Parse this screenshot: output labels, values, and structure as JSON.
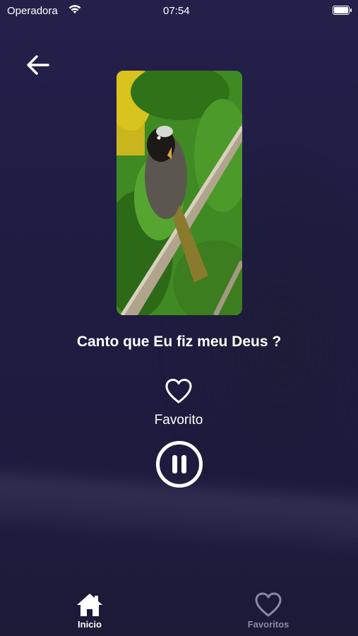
{
  "status_bar": {
    "carrier": "Operadora",
    "time": "07:54"
  },
  "player": {
    "image_alt": "Pássaro em um galho",
    "title": "Canto que Eu fiz meu Deus ?",
    "favorite_label": "Favorito",
    "playing": true
  },
  "tabs": [
    {
      "label": "Inicio",
      "icon": "home-icon",
      "active": true
    },
    {
      "label": "Favoritos",
      "icon": "heart-outline-icon",
      "active": false
    }
  ],
  "colors": {
    "background": "#211e46",
    "active_tab": "#ffffff",
    "inactive_tab": "#8b89a6"
  }
}
